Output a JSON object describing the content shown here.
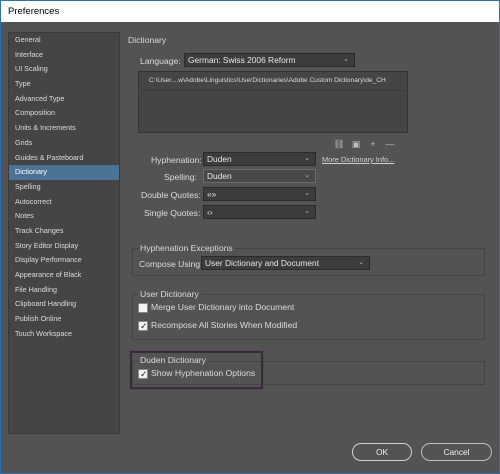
{
  "window": {
    "title": "Preferences"
  },
  "sidebar": {
    "items": [
      {
        "label": "General",
        "active": false
      },
      {
        "label": "Interface",
        "active": false
      },
      {
        "label": "UI Scaling",
        "active": false
      },
      {
        "label": "Type",
        "active": false
      },
      {
        "label": "Advanced Type",
        "active": false
      },
      {
        "label": "Composition",
        "active": false
      },
      {
        "label": "Units & Increments",
        "active": false
      },
      {
        "label": "Grids",
        "active": false
      },
      {
        "label": "Guides & Pasteboard",
        "active": false
      },
      {
        "label": "Dictionary",
        "active": true
      },
      {
        "label": "Spelling",
        "active": false
      },
      {
        "label": "Autocorrect",
        "active": false
      },
      {
        "label": "Notes",
        "active": false
      },
      {
        "label": "Track Changes",
        "active": false
      },
      {
        "label": "Story Editor Display",
        "active": false
      },
      {
        "label": "Display Performance",
        "active": false
      },
      {
        "label": "Appearance of Black",
        "active": false
      },
      {
        "label": "File Handling",
        "active": false
      },
      {
        "label": "Clipboard Handling",
        "active": false
      },
      {
        "label": "Publish Online",
        "active": false
      },
      {
        "label": "Touch Workspace",
        "active": false
      }
    ]
  },
  "dictionary": {
    "section_title": "Dictionary",
    "language_label": "Language:",
    "language_value": "German: Swiss 2006 Reform",
    "dictionary_paths": [
      "C:\\User....w\\Adobe\\Linguistics\\UserDictionaries\\Adobe Custom Dictionary\\de_CH"
    ],
    "hyphenation_label": "Hyphenation:",
    "hyphenation_value": "Duden",
    "more_info_link": "More Dictionary Info...",
    "spelling_label": "Spelling:",
    "spelling_value": "Duden",
    "double_quotes_label": "Double Quotes:",
    "double_quotes_value": "«»",
    "single_quotes_label": "Single Quotes:",
    "single_quotes_value": "‹›"
  },
  "hyphenation_exceptions": {
    "title": "Hyphenation Exceptions",
    "compose_label": "Compose Using:",
    "compose_value": "User Dictionary and Document"
  },
  "user_dictionary": {
    "title": "User Dictionary",
    "merge_label": "Merge User Dictionary into Document",
    "merge_checked": false,
    "recompose_label": "Recompose All Stories When Modified",
    "recompose_checked": true
  },
  "duden_dictionary": {
    "title": "Duden Dictionary",
    "show_hyphenation_label": "Show Hyphenation Options",
    "show_hyphenation_checked": true
  },
  "buttons": {
    "ok": "OK",
    "cancel": "Cancel"
  }
}
